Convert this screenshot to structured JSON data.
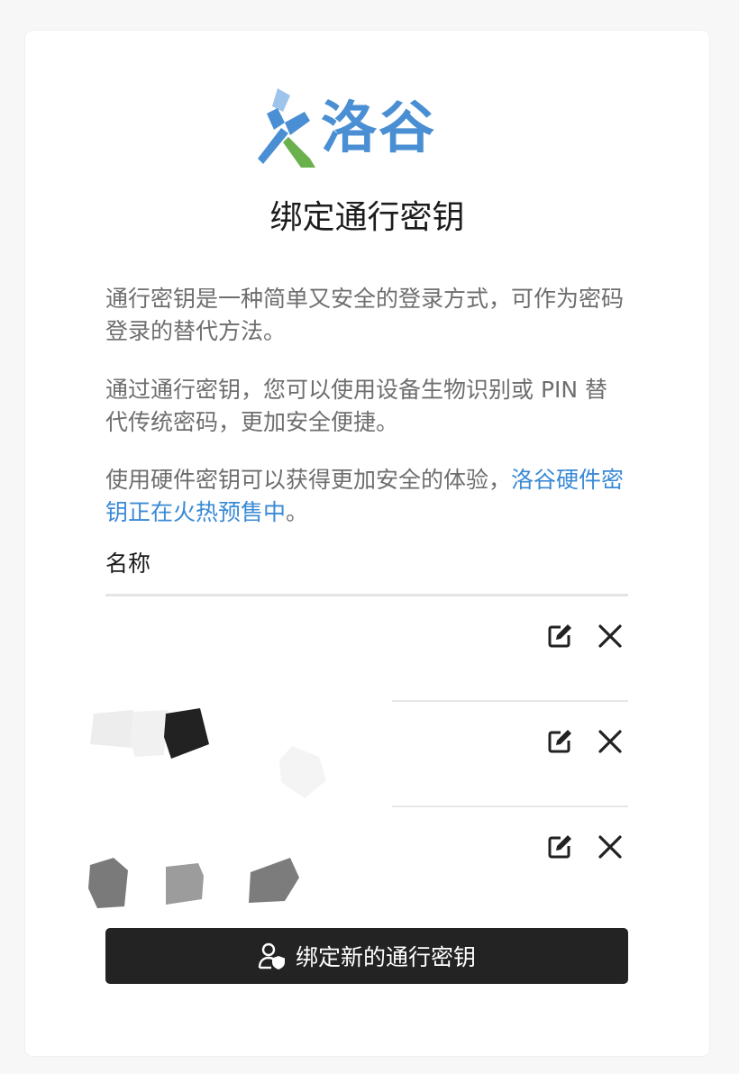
{
  "brand": {
    "name": "洛谷",
    "mark_icon": "luogu-logo",
    "primary_color": "#4a8fd4",
    "accent_light": "#9dc4ea",
    "accent_green": "#6ab04c"
  },
  "title": "绑定通行密钥",
  "paragraphs": {
    "p1": "通行密钥是一种简单又安全的登录方式，可作为密码登录的替代方法。",
    "p2": "通过通行密钥，您可以使用设备生物识别或 PIN 替代传统密码，更加安全便捷。",
    "p3_prefix": "使用硬件密钥可以获得更加安全的体验，",
    "p3_link": "洛谷硬件密钥正在火热预售中",
    "p3_suffix": "。"
  },
  "link_color": "#3a8ad6",
  "table": {
    "header_name": "名称",
    "rows": [
      {
        "name": "",
        "edit_icon": "edit-icon",
        "delete_icon": "close-icon"
      },
      {
        "name": "",
        "edit_icon": "edit-icon",
        "delete_icon": "close-icon"
      },
      {
        "name": "",
        "edit_icon": "edit-icon",
        "delete_icon": "close-icon"
      }
    ]
  },
  "primary_button": {
    "label": "绑定新的通行密钥",
    "icon": "user-shield-icon",
    "background": "#232323"
  }
}
